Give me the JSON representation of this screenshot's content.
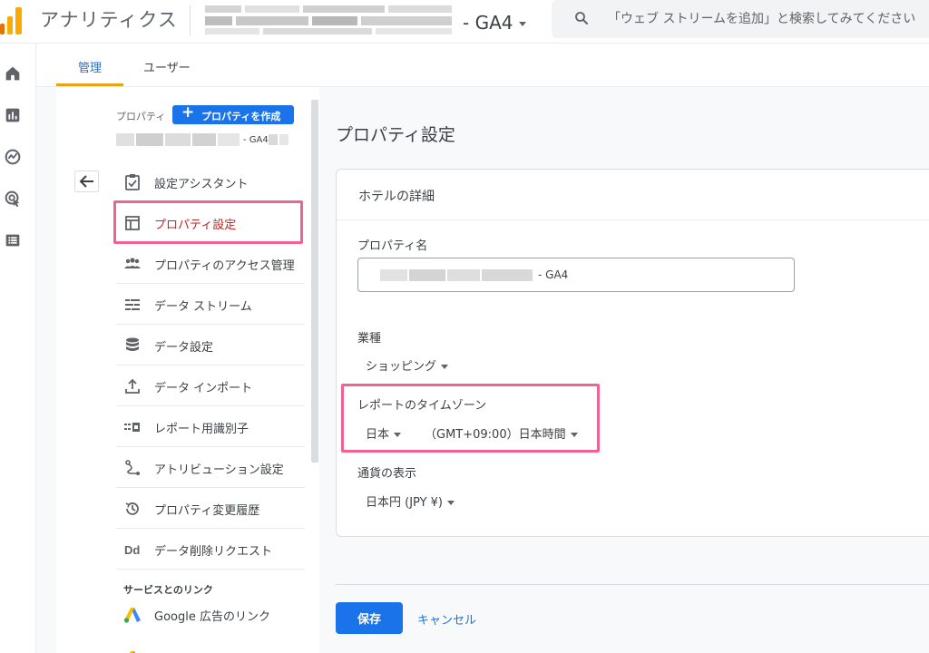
{
  "header": {
    "app_title": "アナリティクス",
    "account_suffix": "- GA4",
    "search_placeholder": "「ウェブ ストリームを追加」と検索してみてください"
  },
  "tabs": [
    {
      "label": "管理",
      "active": true
    },
    {
      "label": "ユーザー",
      "active": false
    }
  ],
  "property": {
    "label": "プロパティ",
    "create_button": "プロパティを作成",
    "name_suffix": "- GA4"
  },
  "nav": {
    "items": [
      {
        "label": "設定アシスタント",
        "icon": "checklist-icon",
        "active": false
      },
      {
        "label": "プロパティ設定",
        "icon": "layout-icon",
        "active": true
      },
      {
        "label": "プロパティのアクセス管理",
        "icon": "people-icon",
        "active": false
      },
      {
        "label": "データ ストリーム",
        "icon": "streams-icon",
        "active": false
      },
      {
        "label": "データ設定",
        "icon": "database-icon",
        "active": false
      },
      {
        "label": "データ インポート",
        "icon": "upload-icon",
        "active": false
      },
      {
        "label": "レポート用識別子",
        "icon": "identifier-icon",
        "active": false
      },
      {
        "label": "アトリビューション設定",
        "icon": "attribution-icon",
        "active": false
      },
      {
        "label": "プロパティ変更履歴",
        "icon": "history-icon",
        "active": false
      },
      {
        "label": "データ削除リクエスト",
        "icon": "dd-icon",
        "active": false
      }
    ],
    "section_links": "サービスとのリンク",
    "google_ads_link": "Google 広告のリンク"
  },
  "main": {
    "page_title": "プロパティ設定",
    "card_title": "ホテルの詳細",
    "property_name_label": "プロパティ名",
    "property_name_suffix": "- GA4",
    "industry_label": "業種",
    "industry_value": "ショッピング",
    "timezone_label": "レポートのタイムゾーン",
    "timezone_country": "日本",
    "timezone_value": "（GMT+09:00）日本時間",
    "currency_label": "通貨の表示",
    "currency_value": "日本円 (JPY ¥)",
    "save": "保存",
    "cancel": "キャンセル"
  },
  "colors": {
    "accent": "#1a73e8",
    "highlight": "#f06292",
    "active_text": "#c5221f",
    "tab_underline": "#e8a317"
  }
}
